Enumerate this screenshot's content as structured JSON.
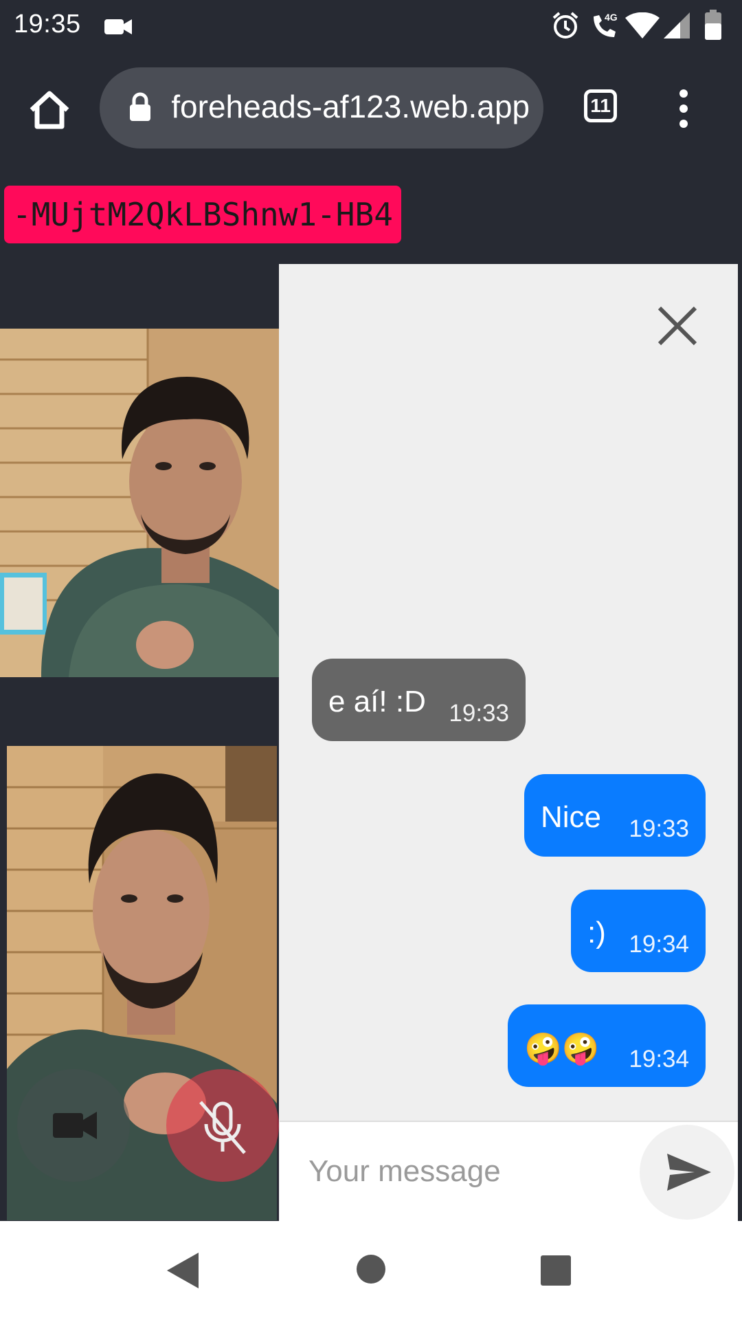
{
  "status_bar": {
    "time": "19:35",
    "icons": [
      "video-camera-icon",
      "alarm-icon",
      "phone-4g-icon",
      "wifi-icon",
      "signal-icon",
      "battery-icon"
    ]
  },
  "browser": {
    "url": "foreheads-af123.web.app",
    "tab_count": "11"
  },
  "room": {
    "id": "-MUjtM2QkLBShnw1-HB4"
  },
  "chat": {
    "messages": [
      {
        "text": "e aí! :D",
        "time": "19:33",
        "direction": "incoming"
      },
      {
        "text": "Nice",
        "time": "19:33",
        "direction": "outgoing"
      },
      {
        "text": ":)",
        "time": "19:34",
        "direction": "outgoing"
      },
      {
        "text": "🤪🤪",
        "time": "19:34",
        "direction": "outgoing"
      }
    ],
    "input_placeholder": "Your message"
  },
  "colors": {
    "room_badge": "#ff0a5a",
    "outgoing_bubble": "#0a7cff",
    "incoming_bubble": "#666666",
    "mic_button": "#e0354a"
  }
}
